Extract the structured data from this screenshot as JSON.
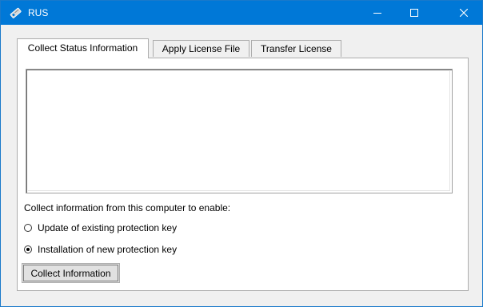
{
  "window": {
    "title": "RUS",
    "accent_color": "#0078d7",
    "icon": "app-key-icon",
    "controls": {
      "minimize_icon": "minimize-icon",
      "maximize_icon": "maximize-icon",
      "close_icon": "close-icon"
    }
  },
  "tabs": [
    {
      "label": "Collect Status Information",
      "active": true
    },
    {
      "label": "Apply License File",
      "active": false
    },
    {
      "label": "Transfer License",
      "active": false
    }
  ],
  "panel": {
    "info_text": "",
    "prompt_label": "Collect information from this computer to enable:",
    "options": [
      {
        "label": "Update of existing protection key",
        "checked": false
      },
      {
        "label": "Installation of new protection key",
        "checked": true
      }
    ],
    "collect_button_label": "Collect Information"
  }
}
